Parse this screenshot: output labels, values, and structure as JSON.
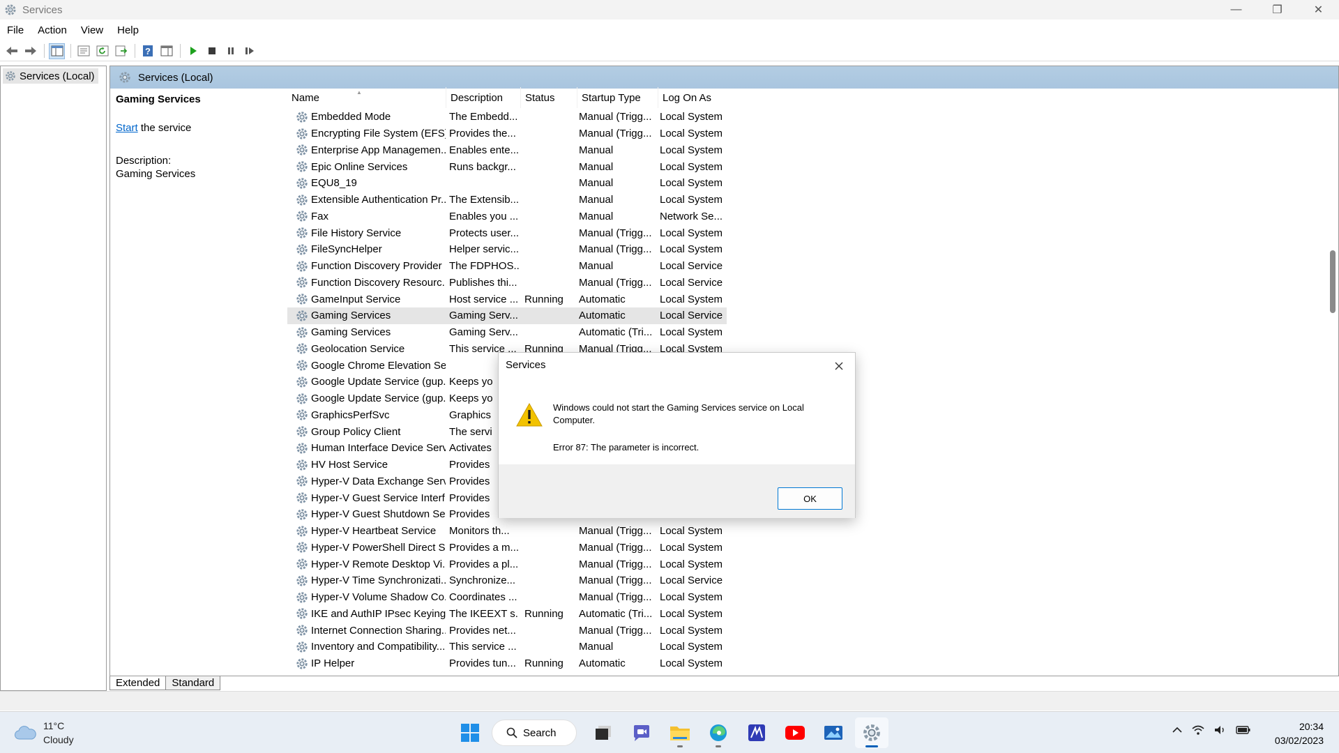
{
  "window": {
    "title": "Services",
    "controls": {
      "minimize": "—",
      "restore": "❐",
      "close": "✕"
    }
  },
  "menu": [
    "File",
    "Action",
    "View",
    "Help"
  ],
  "toolbar": [
    "back-icon",
    "forward-icon",
    "show-hide-console-tree-icon",
    "properties-icon",
    "refresh-icon",
    "export-list-icon",
    "help-icon",
    "show-hide-action-pane-icon",
    "start-service-icon",
    "stop-service-icon",
    "pause-service-icon",
    "resume-service-icon"
  ],
  "tree": {
    "item": "Services (Local)"
  },
  "pane": {
    "header": "Services (Local)"
  },
  "details": {
    "service_title": "Gaming Services",
    "start_link": "Start",
    "start_suffix": " the service",
    "desc_label": "Description:",
    "desc_text": "Gaming Services"
  },
  "columns": {
    "name": "Name",
    "description": "Description",
    "status": "Status",
    "startup": "Startup Type",
    "logon": "Log On As"
  },
  "rows": [
    {
      "name": "Embedded Mode",
      "desc": "The Embedd...",
      "status": "",
      "startup": "Manual (Trigg...",
      "logon": "Local System"
    },
    {
      "name": "Encrypting File System (EFS)",
      "desc": "Provides the...",
      "status": "",
      "startup": "Manual (Trigg...",
      "logon": "Local System"
    },
    {
      "name": "Enterprise App Managemen...",
      "desc": "Enables ente...",
      "status": "",
      "startup": "Manual",
      "logon": "Local System"
    },
    {
      "name": "Epic Online Services",
      "desc": "Runs backgr...",
      "status": "",
      "startup": "Manual",
      "logon": "Local System"
    },
    {
      "name": "EQU8_19",
      "desc": "",
      "status": "",
      "startup": "Manual",
      "logon": "Local System"
    },
    {
      "name": "Extensible Authentication Pr...",
      "desc": "The Extensib...",
      "status": "",
      "startup": "Manual",
      "logon": "Local System"
    },
    {
      "name": "Fax",
      "desc": "Enables you ...",
      "status": "",
      "startup": "Manual",
      "logon": "Network Se..."
    },
    {
      "name": "File History Service",
      "desc": "Protects user...",
      "status": "",
      "startup": "Manual (Trigg...",
      "logon": "Local System"
    },
    {
      "name": "FileSyncHelper",
      "desc": "Helper servic...",
      "status": "",
      "startup": "Manual (Trigg...",
      "logon": "Local System"
    },
    {
      "name": "Function Discovery Provider ...",
      "desc": "The FDPHOS...",
      "status": "",
      "startup": "Manual",
      "logon": "Local Service"
    },
    {
      "name": "Function Discovery Resourc...",
      "desc": "Publishes thi...",
      "status": "",
      "startup": "Manual (Trigg...",
      "logon": "Local Service"
    },
    {
      "name": "GameInput Service",
      "desc": "Host service ...",
      "status": "Running",
      "startup": "Automatic",
      "logon": "Local System"
    },
    {
      "name": "Gaming Services",
      "desc": "Gaming Serv...",
      "status": "",
      "startup": "Automatic",
      "logon": "Local Service",
      "selected": true
    },
    {
      "name": "Gaming Services",
      "desc": "Gaming Serv...",
      "status": "",
      "startup": "Automatic (Tri...",
      "logon": "Local System"
    },
    {
      "name": "Geolocation Service",
      "desc": "This service ...",
      "status": "Running",
      "startup": "Manual (Trigg...",
      "logon": "Local System"
    },
    {
      "name": "Google Chrome Elevation Se...",
      "desc": "",
      "status": "",
      "startup": "",
      "logon": ""
    },
    {
      "name": "Google Update Service (gup...",
      "desc": "Keeps yo",
      "status": "",
      "startup": "",
      "logon": ""
    },
    {
      "name": "Google Update Service (gup...",
      "desc": "Keeps yo",
      "status": "",
      "startup": "",
      "logon": ""
    },
    {
      "name": "GraphicsPerfSvc",
      "desc": "Graphics",
      "status": "",
      "startup": "",
      "logon": ""
    },
    {
      "name": "Group Policy Client",
      "desc": "The servi",
      "status": "",
      "startup": "",
      "logon": ""
    },
    {
      "name": "Human Interface Device Serv...",
      "desc": "Activates",
      "status": "",
      "startup": "",
      "logon": ""
    },
    {
      "name": "HV Host Service",
      "desc": "Provides",
      "status": "",
      "startup": "",
      "logon": ""
    },
    {
      "name": "Hyper-V Data Exchange Serv...",
      "desc": "Provides",
      "status": "",
      "startup": "",
      "logon": ""
    },
    {
      "name": "Hyper-V Guest Service Interf...",
      "desc": "Provides",
      "status": "",
      "startup": "",
      "logon": ""
    },
    {
      "name": "Hyper-V Guest Shutdown Se...",
      "desc": "Provides",
      "status": "",
      "startup": "",
      "logon": ""
    },
    {
      "name": "Hyper-V Heartbeat Service",
      "desc": "Monitors th...",
      "status": "",
      "startup": "Manual (Trigg...",
      "logon": "Local System"
    },
    {
      "name": "Hyper-V PowerShell Direct S...",
      "desc": "Provides a m...",
      "status": "",
      "startup": "Manual (Trigg...",
      "logon": "Local System"
    },
    {
      "name": "Hyper-V Remote Desktop Vi...",
      "desc": "Provides a pl...",
      "status": "",
      "startup": "Manual (Trigg...",
      "logon": "Local System"
    },
    {
      "name": "Hyper-V Time Synchronizati...",
      "desc": "Synchronize...",
      "status": "",
      "startup": "Manual (Trigg...",
      "logon": "Local Service"
    },
    {
      "name": "Hyper-V Volume Shadow Co...",
      "desc": "Coordinates ...",
      "status": "",
      "startup": "Manual (Trigg...",
      "logon": "Local System"
    },
    {
      "name": "IKE and AuthIP IPsec Keying ...",
      "desc": "The IKEEXT s...",
      "status": "Running",
      "startup": "Automatic (Tri...",
      "logon": "Local System"
    },
    {
      "name": "Internet Connection Sharing...",
      "desc": "Provides net...",
      "status": "",
      "startup": "Manual (Trigg...",
      "logon": "Local System"
    },
    {
      "name": "Inventory and Compatibility...",
      "desc": "This service ...",
      "status": "",
      "startup": "Manual",
      "logon": "Local System"
    },
    {
      "name": "IP Helper",
      "desc": "Provides tun...",
      "status": "Running",
      "startup": "Automatic",
      "logon": "Local System"
    }
  ],
  "tabs": [
    "Extended",
    "Standard"
  ],
  "dialog": {
    "title": "Services",
    "message": "Windows could not start the Gaming Services service on Local Computer.",
    "error": "Error 87: The parameter is incorrect.",
    "ok": "OK"
  },
  "taskbar": {
    "weather_temp": "11°C",
    "weather_desc": "Cloudy",
    "search": "Search",
    "time": "20:34",
    "date": "03/02/2023"
  },
  "colors": {
    "selected_row": "#e5e5e5",
    "pane_header": "#b3cde3",
    "accent": "#0078d4",
    "warning": "#f2c200"
  }
}
